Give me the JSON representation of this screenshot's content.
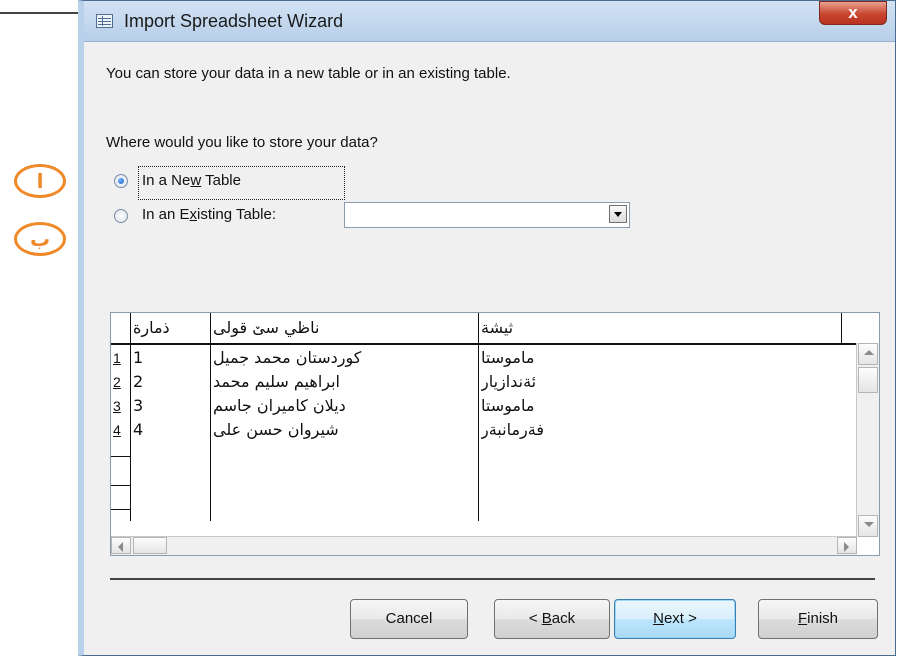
{
  "annotations": {
    "first": "ا",
    "second": "ب"
  },
  "window": {
    "title": "Import Spreadsheet Wizard",
    "close": "x"
  },
  "intro": "You can store your data in a new table or in an existing table.",
  "question": "Where would you like to store your data?",
  "options": {
    "new_table": {
      "before": "In a Ne",
      "mnemonic": "w",
      "after": " Table",
      "checked": true
    },
    "existing_table": {
      "before": "In an E",
      "mnemonic": "x",
      "after": "isting Table:",
      "checked": false,
      "value": ""
    }
  },
  "grid": {
    "headers": {
      "number": "ذمارة",
      "name": "ناظي سێ قولی",
      "job": "ثيشة"
    },
    "rows": [
      {
        "row": "1",
        "number": "1",
        "name": "كوردستان محمد جميل",
        "job": "ماموستا"
      },
      {
        "row": "2",
        "number": "2",
        "name": "ابراهيم سليم محمد",
        "job": "ئةندازيار"
      },
      {
        "row": "3",
        "number": "3",
        "name": "ديلان كاميران جاسم",
        "job": "ماموستا"
      },
      {
        "row": "4",
        "number": "4",
        "name": "شيروان حسن على",
        "job": "فةرمانبةر"
      }
    ]
  },
  "buttons": {
    "cancel": "Cancel",
    "back": {
      "before": "< ",
      "mnemonic": "B",
      "after": "ack"
    },
    "next": {
      "before": "",
      "mnemonic": "N",
      "after": "ext >"
    },
    "finish": {
      "before": "",
      "mnemonic": "F",
      "after": "inish"
    }
  },
  "colors": {
    "annotation": "#ef8a2a",
    "titlebar": "#c4d8ef",
    "close_button": "#c8462f",
    "dialog": "#f0f0f0"
  }
}
